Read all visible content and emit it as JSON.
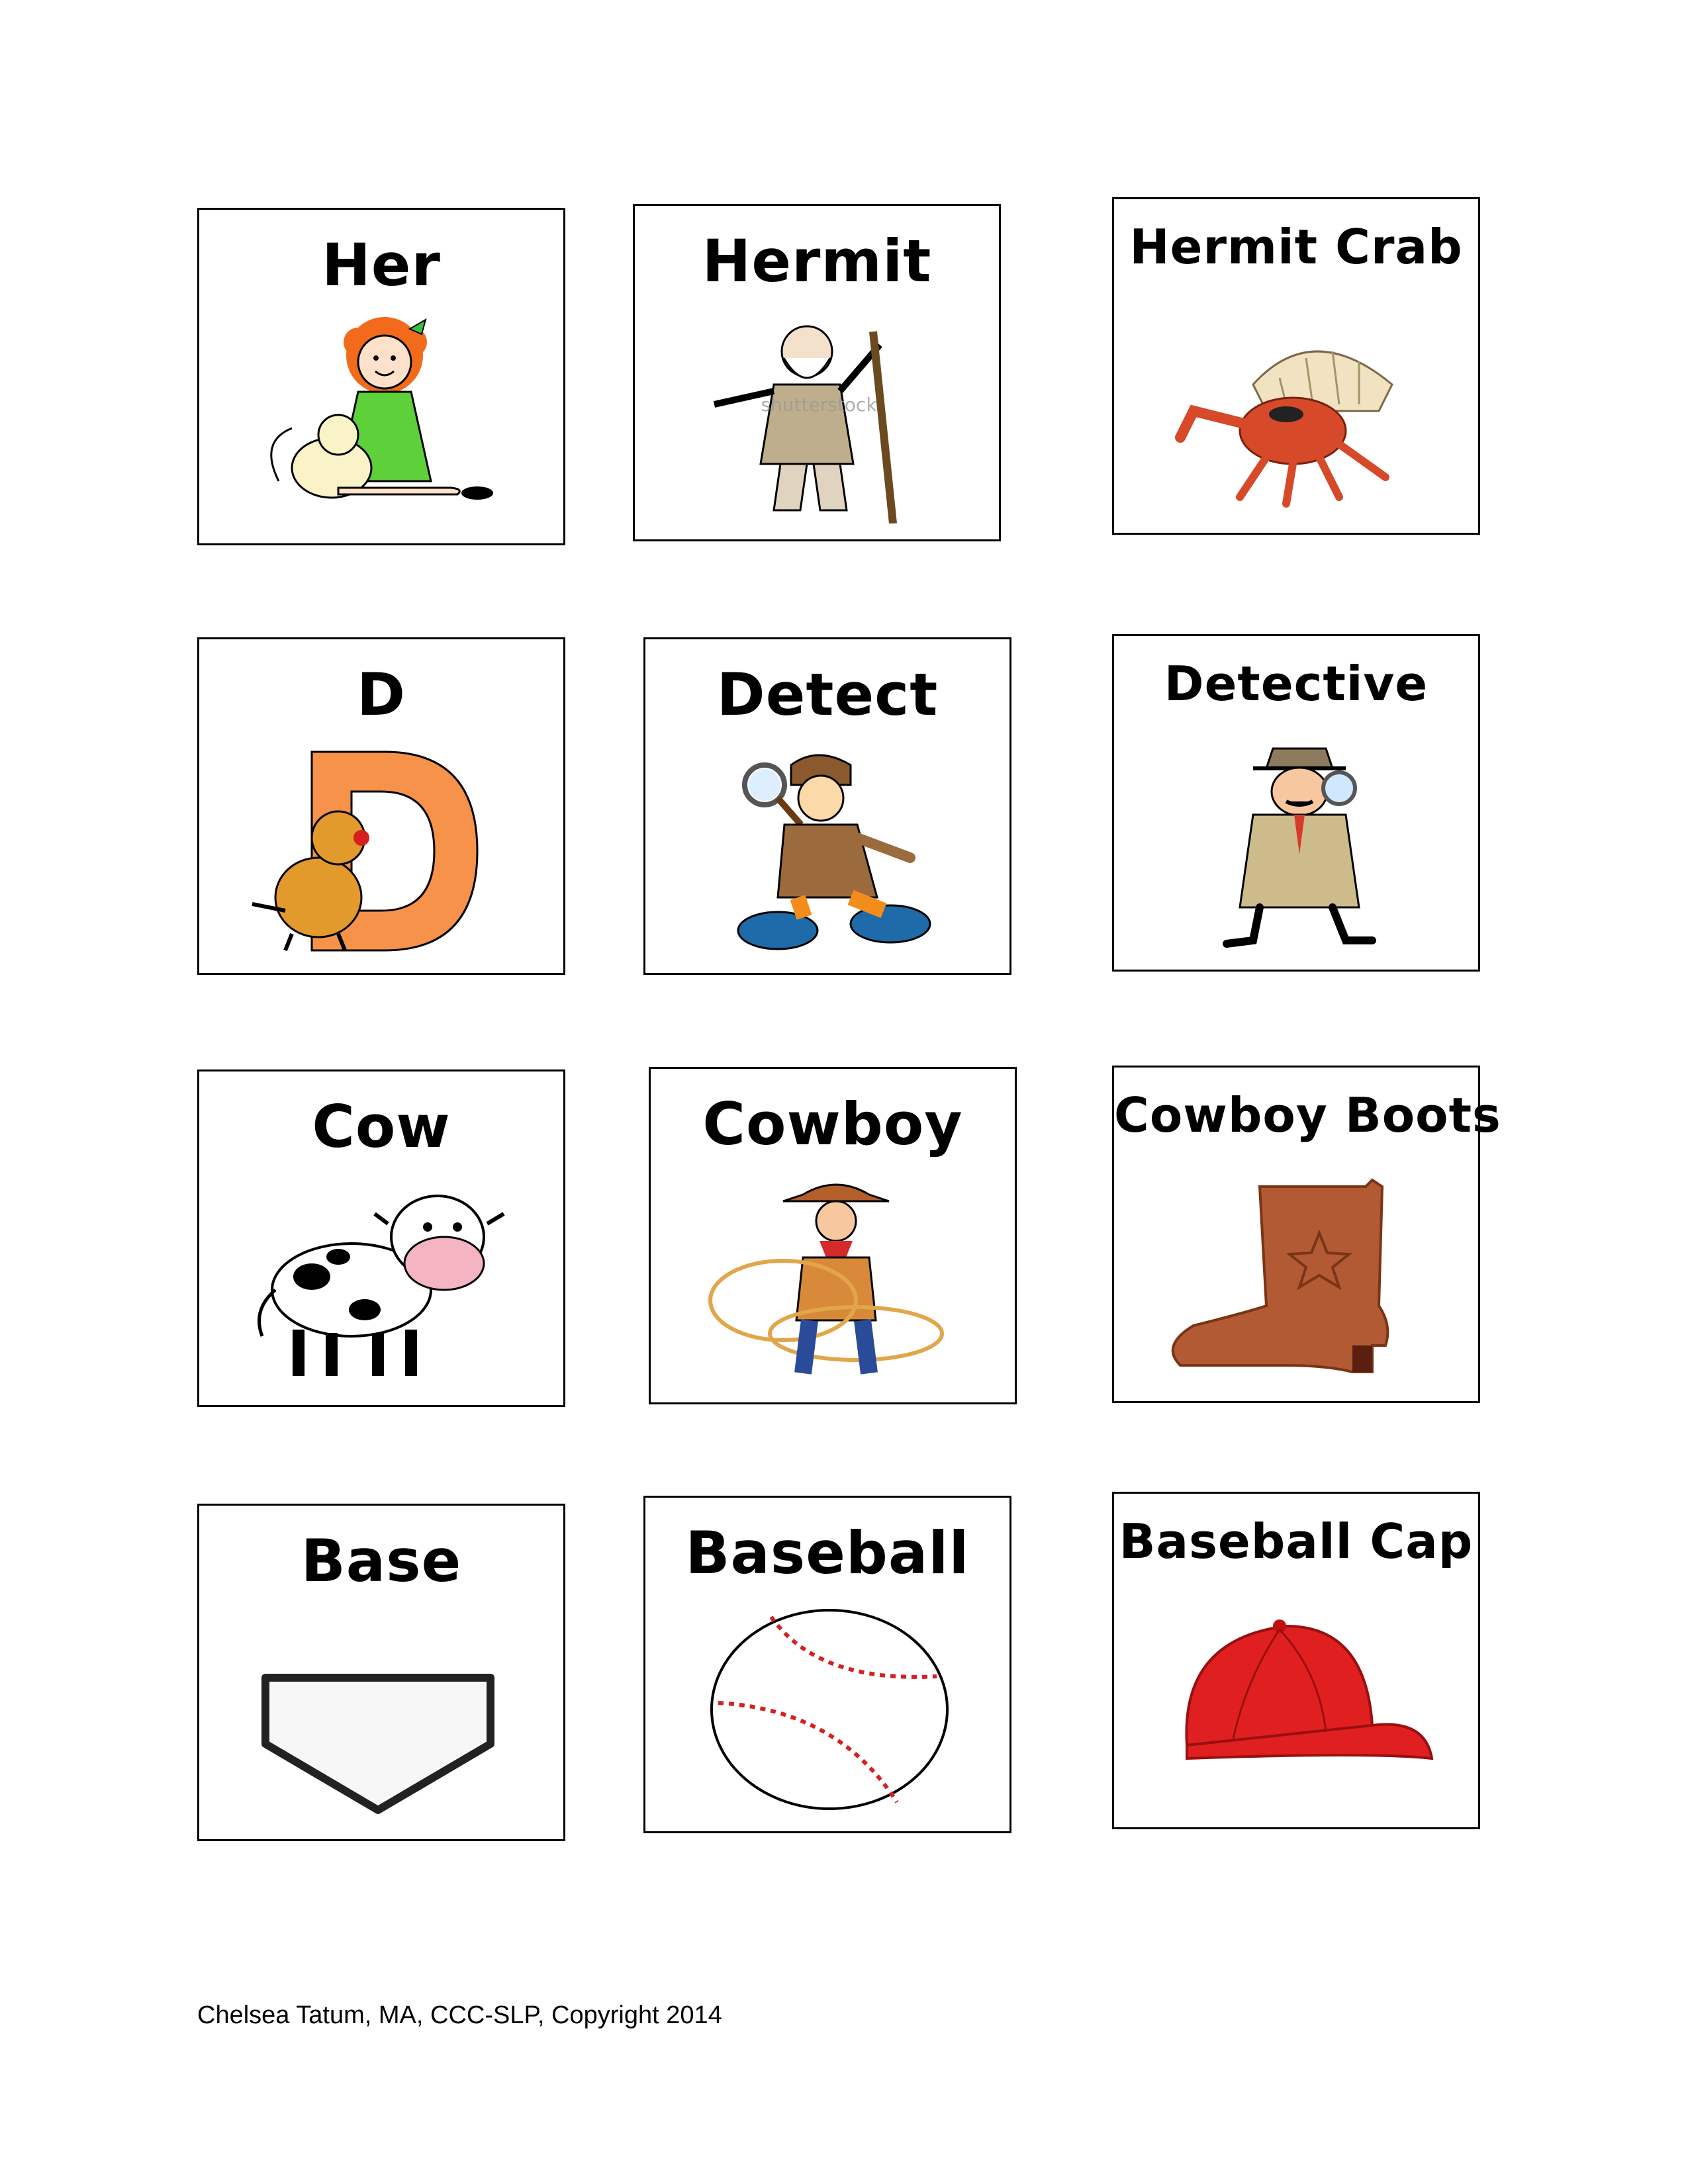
{
  "cards": [
    {
      "label": "Her",
      "picture": "girl-with-cat-picture"
    },
    {
      "label": "Hermit",
      "picture": "hermit-picture",
      "watermark": "shutterstock"
    },
    {
      "label": "Hermit Crab",
      "picture": "hermit-crab-picture"
    },
    {
      "label": "D",
      "picture": "letter-d-picture"
    },
    {
      "label": "Detect",
      "picture": "child-detective-picture"
    },
    {
      "label": "Detective",
      "picture": "detective-picture"
    },
    {
      "label": "Cow",
      "picture": "cow-picture"
    },
    {
      "label": "Cowboy",
      "picture": "cowboy-picture"
    },
    {
      "label": "Cowboy Boots",
      "picture": "cowboy-boot-picture"
    },
    {
      "label": "Base",
      "picture": "home-plate-picture"
    },
    {
      "label": "Baseball",
      "picture": "baseball-picture"
    },
    {
      "label": "Baseball Cap",
      "picture": "baseball-cap-picture"
    }
  ],
  "footer": "Chelsea Tatum, MA, CCC-SLP, Copyright 2014",
  "colors": {
    "border": "#000000",
    "text": "#000000",
    "accent_red": "#e02020",
    "accent_orange": "#f7924a"
  }
}
